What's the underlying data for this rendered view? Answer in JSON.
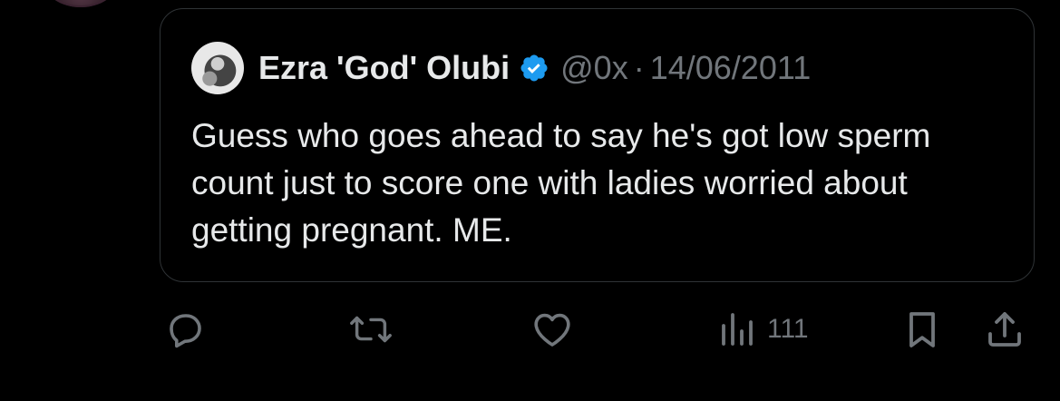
{
  "quoted_tweet": {
    "author_name": "Ezra 'God' Olubi",
    "handle": "@0x",
    "separator": "·",
    "date": "14/06/2011",
    "text": "Guess who goes ahead to say he's got low sperm count just to score one with ladies worried about getting pregnant. ME."
  },
  "actions": {
    "reply_icon": "speech-bubble-icon",
    "retweet_icon": "retweet-icon",
    "like_icon": "heart-icon",
    "views_icon": "bar-chart-icon",
    "views_count": "111",
    "bookmark_icon": "bookmark-icon",
    "share_icon": "share-upload-icon"
  },
  "colors": {
    "background": "#000000",
    "text_primary": "#e7e9ea",
    "text_secondary": "#71767b",
    "border": "#2f3336",
    "verified_blue": "#1d9bf0"
  }
}
